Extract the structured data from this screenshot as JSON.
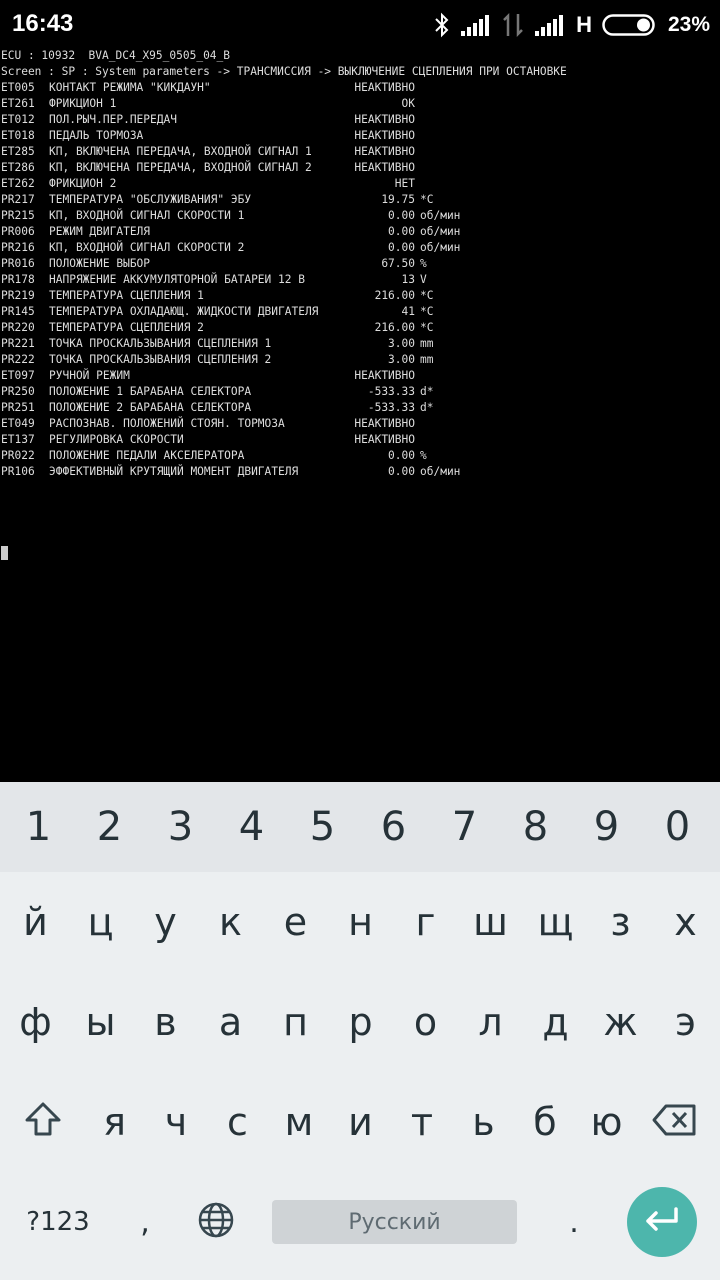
{
  "status_bar": {
    "time": "16:43",
    "network_type": "H",
    "battery_percent": "23%",
    "battery_level": 0.23,
    "icons": [
      "bluetooth-icon",
      "signal-icon",
      "data-arrows-icon",
      "signal-icon-2",
      "battery-icon"
    ]
  },
  "terminal": {
    "header": [
      "ECU : 10932  BVA_DC4_X95_0505_04_B",
      "Screen : SP : System parameters -> ТРАНСМИССИЯ -> ВЫКЛЮЧЕНИЕ СЦЕПЛЕНИЯ ПРИ ОСТАНОВКЕ"
    ],
    "rows": [
      {
        "id": "ET005",
        "name": "КОНТАКТ РЕЖИМА \"КИКДАУН\"",
        "value": "НЕАКТИВНО",
        "unit": ""
      },
      {
        "id": "ET261",
        "name": "ФРИКЦИОН 1",
        "value": "OK",
        "unit": ""
      },
      {
        "id": "ET012",
        "name": "ПОЛ.РЫЧ.ПЕР.ПЕРЕДАЧ",
        "value": "НЕАКТИВНО",
        "unit": ""
      },
      {
        "id": "ET018",
        "name": "ПЕДАЛЬ ТОРМОЗА",
        "value": "НЕАКТИВНО",
        "unit": ""
      },
      {
        "id": "ET285",
        "name": "КП, ВКЛЮЧЕНА ПЕРЕДАЧА, ВХОДНОЙ СИГНАЛ 1",
        "value": "НЕАКТИВНО",
        "unit": ""
      },
      {
        "id": "ET286",
        "name": "КП, ВКЛЮЧЕНА ПЕРЕДАЧА, ВХОДНОЙ СИГНАЛ 2",
        "value": "НЕАКТИВНО",
        "unit": ""
      },
      {
        "id": "ET262",
        "name": "ФРИКЦИОН 2",
        "value": "НЕТ",
        "unit": ""
      },
      {
        "id": "PR217",
        "name": "ТЕМПЕРАТУРА \"ОБСЛУЖИВАНИЯ\" ЭБУ",
        "value": "19.75",
        "unit": "*C"
      },
      {
        "id": "PR215",
        "name": "КП, ВХОДНОЙ СИГНАЛ СКОРОСТИ 1",
        "value": "0.00",
        "unit": "об/мин"
      },
      {
        "id": "PR006",
        "name": "РЕЖИМ ДВИГАТЕЛЯ",
        "value": "0.00",
        "unit": "об/мин"
      },
      {
        "id": "PR216",
        "name": "КП, ВХОДНОЙ СИГНАЛ СКОРОСТИ 2",
        "value": "0.00",
        "unit": "об/мин"
      },
      {
        "id": "PR016",
        "name": "ПОЛОЖЕНИЕ ВЫБОР",
        "value": "67.50",
        "unit": "%"
      },
      {
        "id": "PR178",
        "name": "НАПРЯЖЕНИЕ АККУМУЛЯТОРНОЙ БАТАРЕИ 12 В",
        "value": "13",
        "unit": "V"
      },
      {
        "id": "PR219",
        "name": "ТЕМПЕРАТУРА СЦЕПЛЕНИЯ 1",
        "value": "216.00",
        "unit": "*C"
      },
      {
        "id": "PR145",
        "name": "ТЕМПЕРАТУРА ОХЛАДАЮЩ. ЖИДКОСТИ ДВИГАТЕЛЯ",
        "value": "41",
        "unit": "*C"
      },
      {
        "id": "PR220",
        "name": "ТЕМПЕРАТУРА СЦЕПЛЕНИЯ 2",
        "value": "216.00",
        "unit": "*C"
      },
      {
        "id": "PR221",
        "name": "ТОЧКА ПРОСКАЛЬЗЫВАНИЯ СЦЕПЛЕНИЯ 1",
        "value": "3.00",
        "unit": "mm"
      },
      {
        "id": "PR222",
        "name": "ТОЧКА ПРОСКАЛЬЗЫВАНИЯ СЦЕПЛЕНИЯ 2",
        "value": "3.00",
        "unit": "mm"
      },
      {
        "id": "ET097",
        "name": "РУЧНОЙ РЕЖИМ",
        "value": "НЕАКТИВНО",
        "unit": ""
      },
      {
        "id": "PR250",
        "name": "ПОЛОЖЕНИЕ 1 БАРАБАНА СЕЛЕКТОРА",
        "value": "-533.33",
        "unit": "d*"
      },
      {
        "id": "PR251",
        "name": "ПОЛОЖЕНИЕ 2 БАРАБАНА СЕЛЕКТОРА",
        "value": "-533.33",
        "unit": "d*"
      },
      {
        "id": "ET049",
        "name": "РАСПОЗНАВ. ПОЛОЖЕНИЙ СТОЯН. ТОРМОЗА",
        "value": "НЕАКТИВНО",
        "unit": ""
      },
      {
        "id": "ET137",
        "name": "РЕГУЛИРОВКА СКОРОСТИ",
        "value": "НЕАКТИВНО",
        "unit": ""
      },
      {
        "id": "PR022",
        "name": "ПОЛОЖЕНИЕ ПЕДАЛИ АКСЕЛЕРАТОРА",
        "value": "0.00",
        "unit": "%"
      },
      {
        "id": "PR106",
        "name": "ЭФФЕКТИВНЫЙ КРУТЯЩИЙ МОМЕНТ ДВИГАТЕЛЯ",
        "value": "0.00",
        "unit": "об/мин"
      }
    ]
  },
  "keyboard": {
    "number_row": [
      "1",
      "2",
      "3",
      "4",
      "5",
      "6",
      "7",
      "8",
      "9",
      "0"
    ],
    "row1": [
      "й",
      "ц",
      "у",
      "к",
      "е",
      "н",
      "г",
      "ш",
      "щ",
      "з",
      "х"
    ],
    "row2": [
      "ф",
      "ы",
      "в",
      "а",
      "п",
      "р",
      "о",
      "л",
      "д",
      "ж",
      "э"
    ],
    "row3": [
      "я",
      "ч",
      "с",
      "м",
      "и",
      "т",
      "ь",
      "б",
      "ю"
    ],
    "symbols_label": "?123",
    "comma": ",",
    "period": ".",
    "space_label": "Русский"
  }
}
